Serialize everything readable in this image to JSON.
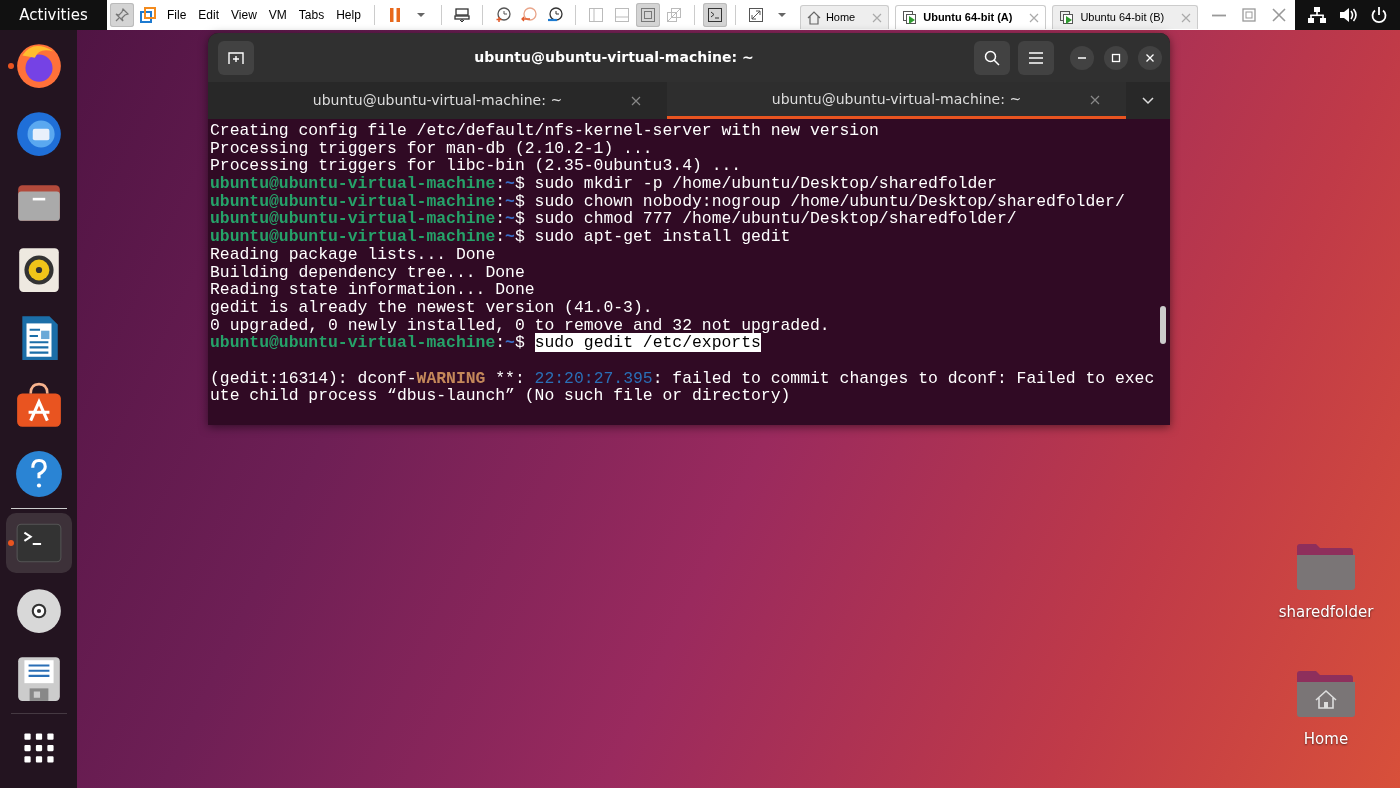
{
  "top_bar": {
    "activities": "Activities"
  },
  "vmware": {
    "tools": [
      {
        "kind": "pin",
        "pressed": true
      },
      {
        "kind": "logo",
        "pressed": false
      }
    ],
    "menus": [
      "File",
      "Edit",
      "View",
      "VM",
      "Tabs",
      "Help"
    ],
    "toolbar": [
      {
        "kind": "pause",
        "pressed": false
      },
      {
        "kind": "caret",
        "pressed": false
      },
      {
        "kind": "sep"
      },
      {
        "kind": "send",
        "pressed": false
      },
      {
        "kind": "sep"
      },
      {
        "kind": "snap",
        "pressed": false
      },
      {
        "kind": "revert",
        "pressed": false
      },
      {
        "kind": "manage",
        "pressed": false
      },
      {
        "kind": "sep"
      },
      {
        "kind": "library",
        "pressed": false
      },
      {
        "kind": "thumb",
        "pressed": false
      },
      {
        "kind": "full",
        "pressed": true
      },
      {
        "kind": "unity",
        "pressed": false
      },
      {
        "kind": "sep"
      },
      {
        "kind": "console",
        "pressed": true
      },
      {
        "kind": "sep"
      },
      {
        "kind": "stretch",
        "pressed": false
      },
      {
        "kind": "caret",
        "pressed": false
      }
    ],
    "tabs": [
      {
        "label": "Home",
        "kind": "home",
        "selected": false
      },
      {
        "label": "Ubuntu 64-bit (A)",
        "kind": "vm",
        "selected": true
      },
      {
        "label": "Ubuntu 64-bit (B)",
        "kind": "vm",
        "selected": false
      }
    ]
  },
  "dock": {
    "items": [
      {
        "kind": "firefox",
        "running": true,
        "active": false
      },
      {
        "kind": "mail",
        "running": false,
        "active": false
      },
      {
        "kind": "files",
        "running": false,
        "active": false
      },
      {
        "kind": "speaker",
        "running": false,
        "active": false
      },
      {
        "kind": "writer",
        "running": false,
        "active": false
      },
      {
        "kind": "store",
        "running": false,
        "active": false
      },
      {
        "kind": "help",
        "running": false,
        "active": false
      },
      {
        "kind": "terminal",
        "running": true,
        "active": true
      },
      {
        "kind": "disc",
        "running": false,
        "active": false
      },
      {
        "kind": "disk",
        "running": false,
        "active": false
      },
      {
        "kind": "grid",
        "running": false,
        "active": false
      }
    ]
  },
  "terminal": {
    "title": "ubuntu@ubuntu-virtual-machine: ~",
    "tabs": [
      {
        "label": "ubuntu@ubuntu-virtual-machine: ~",
        "selected": false
      },
      {
        "label": "ubuntu@ubuntu-virtual-machine: ~",
        "selected": true
      }
    ],
    "lines": [
      {
        "kind": "text",
        "segments": [
          {
            "text": "Creating config file /etc/default/nfs-kernel-server with new version",
            "kind": "plain"
          }
        ]
      },
      {
        "kind": "text",
        "segments": [
          {
            "text": "Processing triggers for man-db (2.10.2-1) ...",
            "kind": "plain"
          }
        ]
      },
      {
        "kind": "text",
        "segments": [
          {
            "text": "Processing triggers for libc-bin (2.35-0ubuntu3.4) ...",
            "kind": "plain"
          }
        ]
      },
      {
        "kind": "text",
        "segments": [
          {
            "text": "ubuntu@ubuntu-virtual-machine",
            "kind": "user"
          },
          {
            "text": ":",
            "kind": "plain"
          },
          {
            "text": "~",
            "kind": "path"
          },
          {
            "text": "$ sudo mkdir -p /home/ubuntu/Desktop/sharedfolder",
            "kind": "plain"
          }
        ]
      },
      {
        "kind": "text",
        "segments": [
          {
            "text": "ubuntu@ubuntu-virtual-machine",
            "kind": "user"
          },
          {
            "text": ":",
            "kind": "plain"
          },
          {
            "text": "~",
            "kind": "path"
          },
          {
            "text": "$ sudo chown nobody:nogroup /home/ubuntu/Desktop/sharedfolder/",
            "kind": "plain"
          }
        ]
      },
      {
        "kind": "text",
        "segments": [
          {
            "text": "ubuntu@ubuntu-virtual-machine",
            "kind": "user"
          },
          {
            "text": ":",
            "kind": "plain"
          },
          {
            "text": "~",
            "kind": "path"
          },
          {
            "text": "$ sudo chmod 777 /home/ubuntu/Desktop/sharedfolder/",
            "kind": "plain"
          }
        ]
      },
      {
        "kind": "text",
        "segments": [
          {
            "text": "ubuntu@ubuntu-virtual-machine",
            "kind": "user"
          },
          {
            "text": ":",
            "kind": "plain"
          },
          {
            "text": "~",
            "kind": "path"
          },
          {
            "text": "$ sudo apt-get install gedit",
            "kind": "plain"
          }
        ]
      },
      {
        "kind": "text",
        "segments": [
          {
            "text": "Reading package lists... Done",
            "kind": "plain"
          }
        ]
      },
      {
        "kind": "text",
        "segments": [
          {
            "text": "Building dependency tree... Done",
            "kind": "plain"
          }
        ]
      },
      {
        "kind": "text",
        "segments": [
          {
            "text": "Reading state information... Done",
            "kind": "plain"
          }
        ]
      },
      {
        "kind": "text",
        "segments": [
          {
            "text": "gedit is already the newest version (41.0-3).",
            "kind": "plain"
          }
        ]
      },
      {
        "kind": "text",
        "segments": [
          {
            "text": "0 upgraded, 0 newly installed, 0 to remove and 32 not upgraded.",
            "kind": "plain"
          }
        ]
      },
      {
        "kind": "text",
        "segments": [
          {
            "text": "ubuntu@ubuntu-virtual-machine",
            "kind": "user"
          },
          {
            "text": ":",
            "kind": "plain"
          },
          {
            "text": "~",
            "kind": "path"
          },
          {
            "text": "$ ",
            "kind": "plain"
          },
          {
            "text": "sudo gedit /etc/exports",
            "kind": "selection"
          }
        ]
      },
      {
        "kind": "blank"
      },
      {
        "kind": "text",
        "segments": [
          {
            "text": "(gedit:16314): dconf-",
            "kind": "plain"
          },
          {
            "text": "WARNING",
            "kind": "warning"
          },
          {
            "text": " **: ",
            "kind": "plain"
          },
          {
            "text": "22:20:27.395",
            "kind": "time"
          },
          {
            "text": ": failed to commit changes to dconf: Failed to exec",
            "kind": "plain"
          }
        ]
      },
      {
        "kind": "text",
        "segments": [
          {
            "text": "ute child process “dbus-launch” (No such file or directory)",
            "kind": "plain"
          }
        ]
      }
    ]
  },
  "desktop_icons": [
    {
      "label": "sharedfolder",
      "kind": "folder"
    },
    {
      "label": "Home",
      "kind": "home"
    }
  ]
}
